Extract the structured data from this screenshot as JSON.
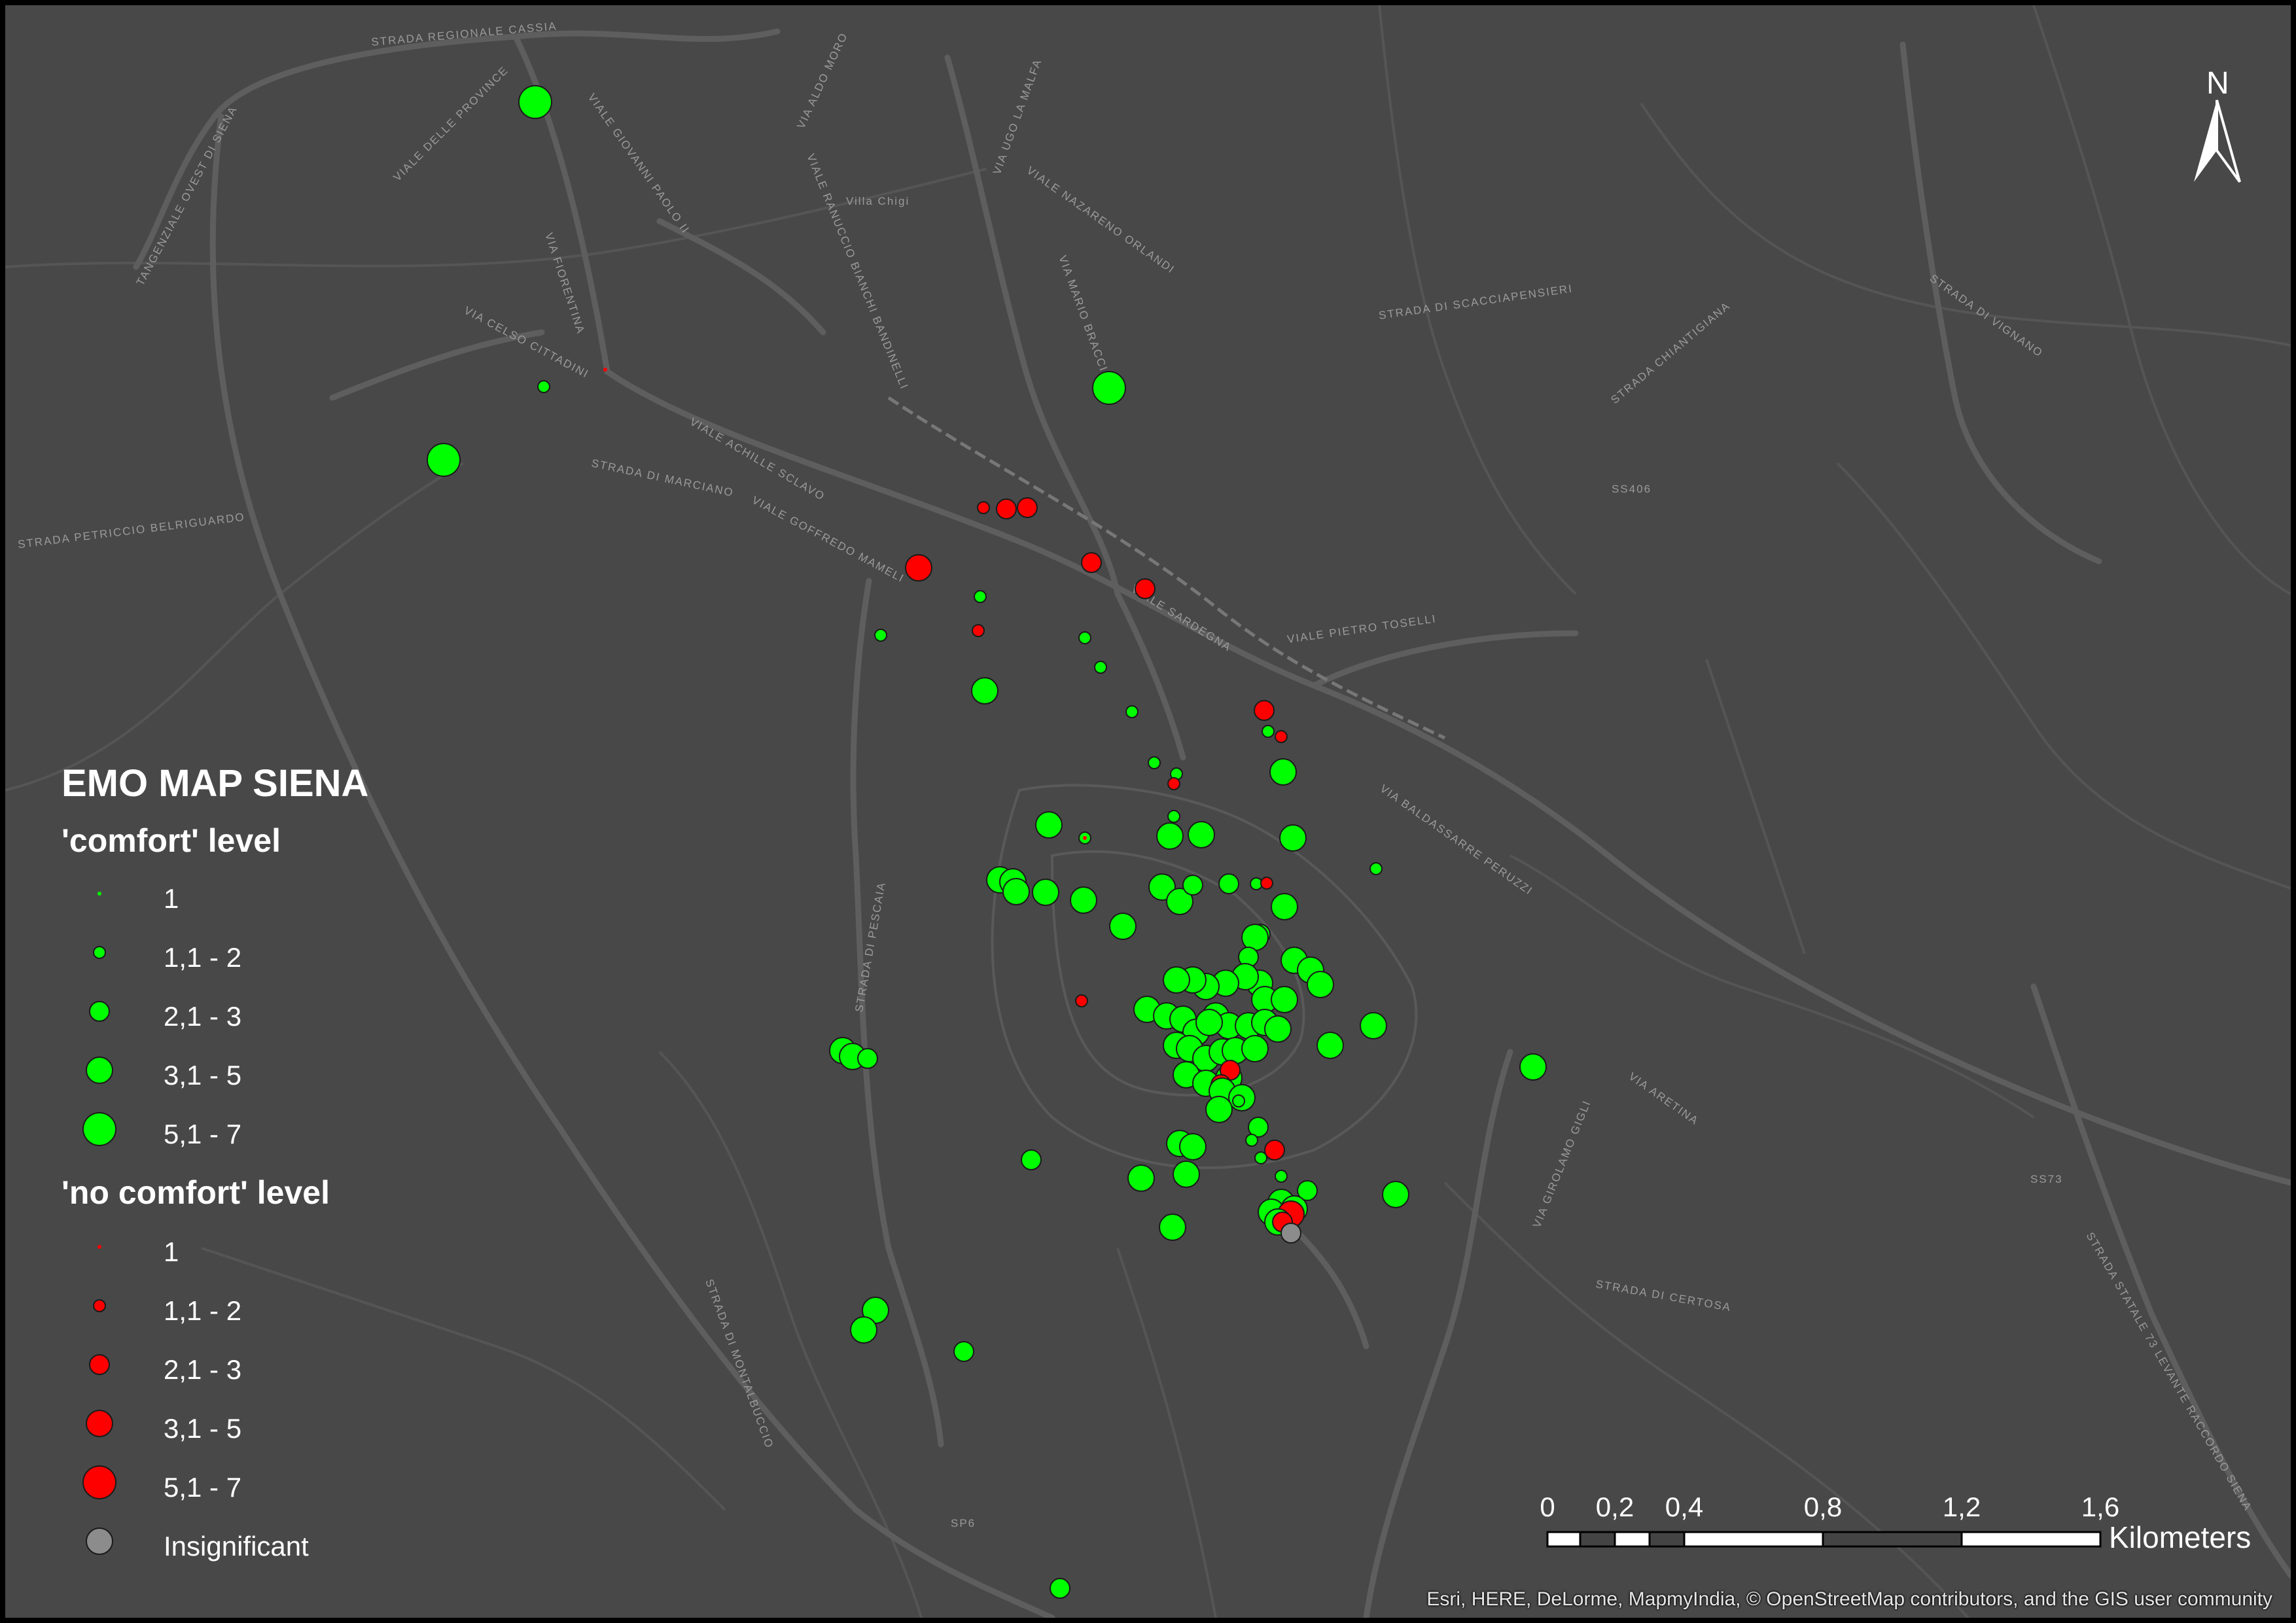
{
  "map": {
    "title": "EMO MAP SIENA",
    "north_label": "N",
    "attribution": "Esri, HERE, DeLorme, MapmyIndia, © OpenStreetMap contributors, and the GIS user community",
    "background_color": "#484848",
    "road_color": "#5e5e5e",
    "comfort_color": "#00ff00",
    "no_comfort_color": "#ff0000",
    "insignificant_color": "#8c8c8c",
    "icons": [
      "north-arrow-icon"
    ]
  },
  "legend": {
    "comfort_title": "'comfort' level",
    "no_comfort_title": "'no comfort' level",
    "comfort_classes": [
      "1",
      "1,1 - 2",
      "2,1 - 3",
      "3,1 - 5",
      "5,1 - 7"
    ],
    "no_comfort_classes": [
      "1",
      "1,1 - 2",
      "2,1 - 3",
      "3,1 - 5",
      "5,1 - 7"
    ],
    "insignificant_label": "Insignificant"
  },
  "scale_bar": {
    "ticks": [
      "0",
      "0,2",
      "0,4",
      "0,8",
      "1,2",
      "1,6"
    ],
    "unit": "Kilometers"
  },
  "street_labels": [
    "STRADA REGIONALE CASSIA",
    "TANGENZIALE OVEST DI SIENA",
    "VIALE DELLE PROVINCE",
    "VIALE GIOVANNI PAOLO II",
    "VIA FIORENTINA",
    "VIA CELSO CITTADINI",
    "VIALE ACHILLE SCLAVO",
    "STRADA DI MARCIANO",
    "STRADA PETRICCIO BELRIGUARDO",
    "VIALE GOFFREDO MAMELI",
    "VIA ALDO MORO",
    "VIA UGO LA MALFA",
    "VIALE NAZARENO ORLANDI",
    "VIA MARIO BRACCI",
    "VIALE RANUCCIO BIANCHI BANDINELLI",
    "STRADA DI SCACCIAPENSIERI",
    "STRADA CHIANTIGIANA",
    "STRADA DI VIGNANO",
    "VIALE SARDEGNA",
    "VIALE PIETRO TOSELLI",
    "VIA BALDASSARRE PERUZZI",
    "STRADA DI PESCAIA",
    "VIA ARETINA",
    "VIA GIROLAMO GIGLI",
    "STRADA DI MONTALBUCCIO",
    "STRADA DI CERTOSA",
    "STRADA STATALE 73 LEVANTE RACCORDO SIENA",
    "SS406",
    "SS73",
    "SP6",
    "Villa Chigi"
  ]
}
